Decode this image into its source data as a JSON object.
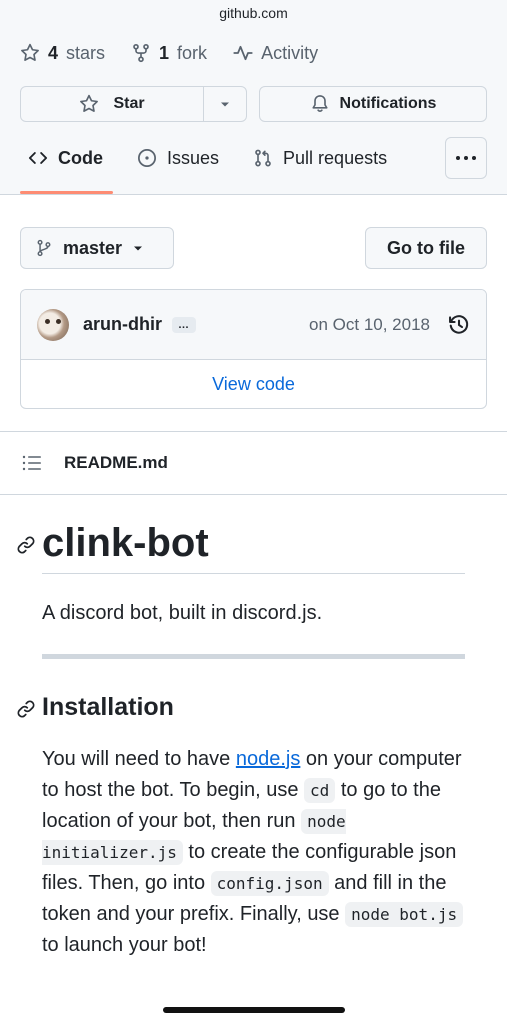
{
  "browser": {
    "url": "github.com"
  },
  "repo_meta": {
    "stars_count": "4",
    "stars_label": "stars",
    "forks_count": "1",
    "forks_label": "fork",
    "activity_label": "Activity"
  },
  "actions": {
    "star_label": "Star",
    "notifications_label": "Notifications"
  },
  "tabs": [
    {
      "label": "Code",
      "icon": "code-icon",
      "active": true
    },
    {
      "label": "Issues",
      "icon": "issue-icon",
      "active": false
    },
    {
      "label": "Pull requests",
      "icon": "pull-request-icon",
      "active": false
    }
  ],
  "branch": {
    "name": "master",
    "go_to_file": "Go to file"
  },
  "commit": {
    "author": "arun-dhir",
    "ellipsis": "…",
    "date": "on Oct 10, 2018",
    "view_code": "View code"
  },
  "readme": {
    "filename": "README.md",
    "title": "clink-bot",
    "description": "A discord bot, built in discord.js.",
    "installation_heading": "Installation",
    "install": {
      "t1": "You will need to have ",
      "link": "node.js",
      "t2": " on your computer to host the bot. To begin, use ",
      "code1": "cd",
      "t3": " to go to the location of your bot, then run ",
      "code2": "node initializer.js",
      "t4": " to create the configurable json files. Then, go into ",
      "code3": "config.json",
      "t5": " and fill in the token and your prefix. Finally, use ",
      "code4": "node bot.js",
      "t6": " to launch your bot!"
    }
  },
  "colors": {
    "accent_tab": "#fd8c73",
    "link": "#0969da",
    "text": "#1f2328",
    "muted": "#59636e"
  }
}
